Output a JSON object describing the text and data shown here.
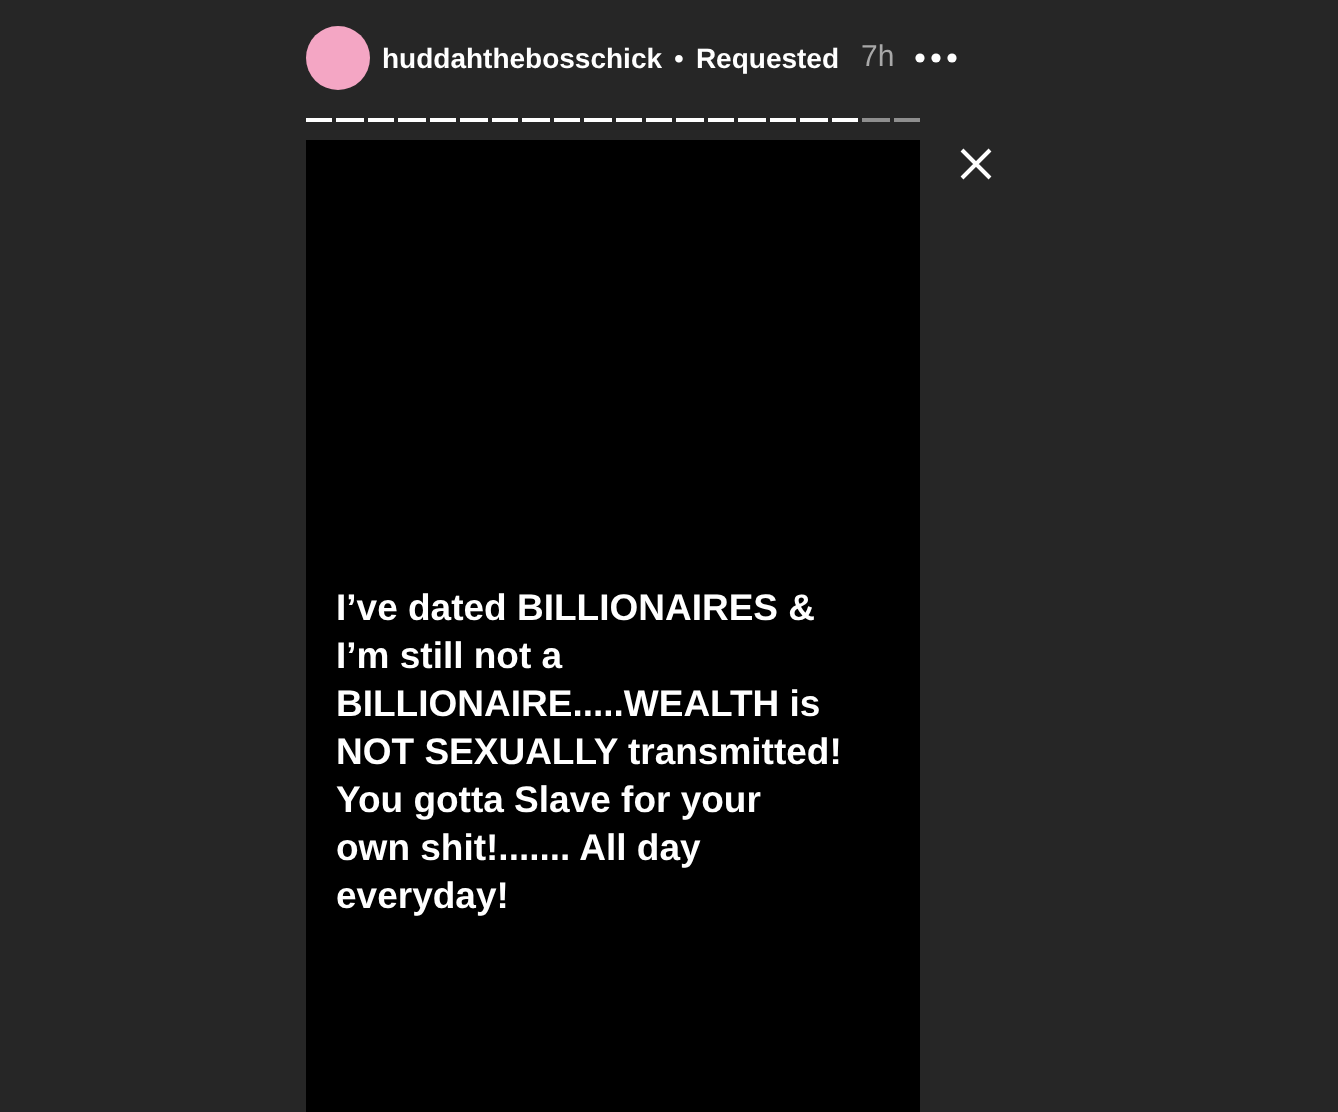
{
  "header": {
    "username": "huddahthebosschick",
    "separator": "•",
    "follow_status": "Requested",
    "time": "7h"
  },
  "progress": [
    {
      "seen": true
    },
    {
      "seen": true
    },
    {
      "seen": true
    },
    {
      "seen": true
    },
    {
      "seen": true
    },
    {
      "seen": true
    },
    {
      "seen": true
    },
    {
      "seen": true
    },
    {
      "seen": true
    },
    {
      "seen": true
    },
    {
      "seen": true
    },
    {
      "seen": true
    },
    {
      "seen": true
    },
    {
      "seen": true
    },
    {
      "seen": true
    },
    {
      "seen": true
    },
    {
      "seen": true
    },
    {
      "seen": true
    },
    {
      "seen": false
    },
    {
      "seen": false
    }
  ],
  "story": {
    "text": "I’ve dated BILLIONAIRES &\nI’m still not a\nBILLIONAIRE.....WEALTH is\nNOT SEXUALLY transmitted!\nYou gotta Slave for your\nown shit!....... All day\neveryday!"
  }
}
